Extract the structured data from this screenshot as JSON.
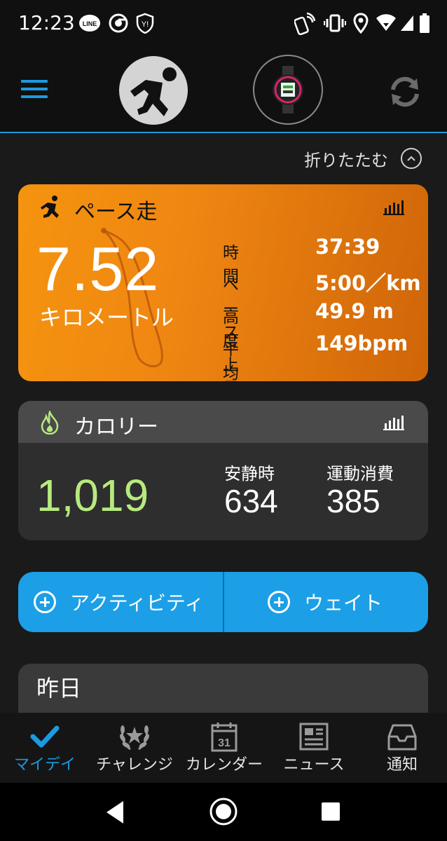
{
  "status_bar": {
    "time": "12:23",
    "left_icons": [
      "line-icon",
      "chrome-icon",
      "yahoo-shield-icon"
    ],
    "right_icons": [
      "nfc-icon",
      "vibrate-icon",
      "location-icon",
      "wifi-icon",
      "signal-icon",
      "battery-icon"
    ]
  },
  "header": {
    "menu_icon": "hamburger-icon",
    "avatar_icon": "running-person-icon",
    "device_icon": "watch-icon",
    "sync_icon": "sync-icon"
  },
  "collapse": {
    "label": "折りたたむ",
    "icon": "chevron-up-icon"
  },
  "activity": {
    "title": "ペース走",
    "distance": "7.52",
    "distance_unit": "キロメートル",
    "stats": [
      {
        "label": "時間",
        "value": "37:39"
      },
      {
        "label": "ペース",
        "value": "5:00／km"
      },
      {
        "label": "高度上昇",
        "value": "49.9 m"
      },
      {
        "label": "平均心拍",
        "value": "149bpm"
      }
    ],
    "accent_color": "#f5940f"
  },
  "calories": {
    "title": "カロリー",
    "total": "1,019",
    "resting_label": "安静時",
    "resting_value": "634",
    "active_label": "運動消費",
    "active_value": "385",
    "total_color": "#b7ea7e"
  },
  "add_buttons": {
    "activity_label": "アクティビティ",
    "weight_label": "ウェイト",
    "color": "#1c9fe6"
  },
  "yesterday": {
    "title": "昨日"
  },
  "bottom_nav": [
    {
      "label": "マイデイ",
      "icon": "check-icon",
      "active": true
    },
    {
      "label": "チャレンジ",
      "icon": "laurel-icon",
      "active": false
    },
    {
      "label": "カレンダー",
      "icon": "calendar-icon",
      "day": "31",
      "active": false
    },
    {
      "label": "ニュース",
      "icon": "news-icon",
      "active": false
    },
    {
      "label": "通知",
      "icon": "inbox-icon",
      "active": false
    }
  ]
}
